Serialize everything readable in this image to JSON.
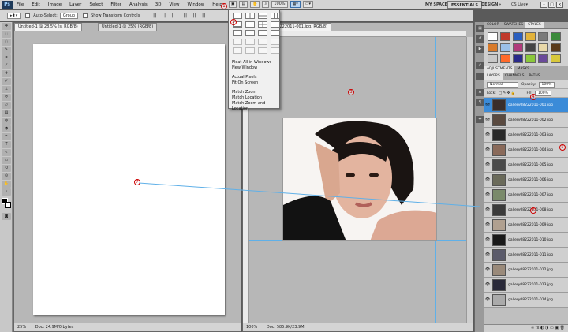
{
  "menubar": {
    "logo": "Ps",
    "items": [
      "File",
      "Edit",
      "Image",
      "Layer",
      "Select",
      "Filter",
      "Analysis",
      "3D",
      "View",
      "Window",
      "Help"
    ],
    "zoom": "100%",
    "workspaces": [
      "MY SPACE",
      "ESSENTIALS",
      "DESIGN"
    ],
    "more": "»",
    "cslive": "CS Live▾",
    "win_controls": [
      "–",
      "□",
      "×"
    ]
  },
  "options": {
    "auto_select_label": "Auto-Select:",
    "auto_select_value": "Group",
    "transform_label": "Show Transform Controls"
  },
  "arrange_menu": {
    "entries": [
      "Float All in Windows",
      "New Window",
      "Actual Pixels",
      "Fit On Screen",
      "Match Zoom",
      "Match Location",
      "Match Zoom and Location"
    ]
  },
  "doc_left": {
    "tabs": [
      "Untitled-1 @ 28.5% (s, RGB/8)",
      "Untitled-1 @ 25% (RGB/8)"
    ],
    "zoom": "25%",
    "doc_info": "Doc: 24.9M/0 bytes"
  },
  "doc_right": {
    "tab": "gallery08222011-001.jpg, RGB/8)",
    "zoom": "100%",
    "doc_info": "Doc: 585.9K/23.9M"
  },
  "panels": {
    "top_tabs": [
      "COLOR",
      "SWATCHES",
      "STYLES"
    ],
    "mid_tabs": [
      "ADJUSTMENTS",
      "MASKS"
    ],
    "layer_tabs": [
      "LAYERS",
      "CHANNELS",
      "PATHS"
    ],
    "blend_mode": "Normal",
    "opacity_label": "Opacity:",
    "opacity_value": "100%",
    "lock_label": "Lock:",
    "fill_label": "Fill:",
    "fill_value": "100%",
    "footer_icons": "∞ fx ◐ ◑ ▭ ▣ 🗑"
  },
  "layers": [
    "gallery08222011-001.jpg",
    "gallery08222011-002.jpg",
    "gallery08222011-003.jpg",
    "gallery08222011-004.jpg",
    "gallery08222011-005.jpg",
    "gallery08222011-006.jpg",
    "gallery08222011-007.jpg",
    "gallery08222011-008.jpg",
    "gallery08222011-009.jpg",
    "gallery08222011-010.jpg",
    "gallery08222011-011.jpg",
    "gallery08222011-012.jpg",
    "gallery08222011-013.jpg",
    "gallery08222011-014.jpg"
  ],
  "markers": [
    "1",
    "2",
    "3",
    "4",
    "5",
    "6",
    "7"
  ],
  "colors": {
    "selected_layer": "#3b8bd8",
    "guide": "#5fb0e8",
    "marker": "#cc0000"
  }
}
